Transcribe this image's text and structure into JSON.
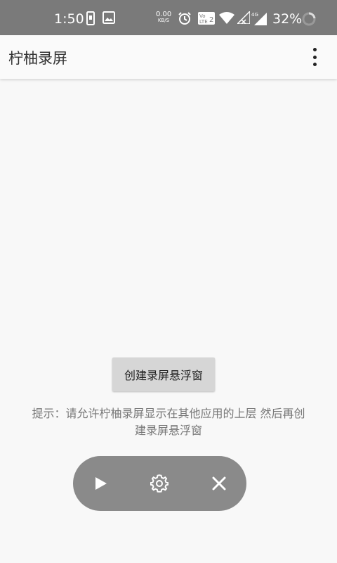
{
  "status_bar": {
    "time": "1:50",
    "net_speed_value": "0.00",
    "net_speed_unit": "KB/S",
    "battery_percent": "32%",
    "background_color": "#7a7a7a"
  },
  "app_bar": {
    "title": "柠柚录屏",
    "menu_icon": "more-vert-icon"
  },
  "main": {
    "create_button_label": "创建录屏悬浮窗",
    "hint_text": "提示：请允许柠柚录屏显示在其他应用的上层 然后再创建录屏悬浮窗"
  },
  "floating_controls": {
    "buttons": [
      "play-icon",
      "settings-icon",
      "close-icon"
    ],
    "background_color": "#8a8a8a"
  }
}
